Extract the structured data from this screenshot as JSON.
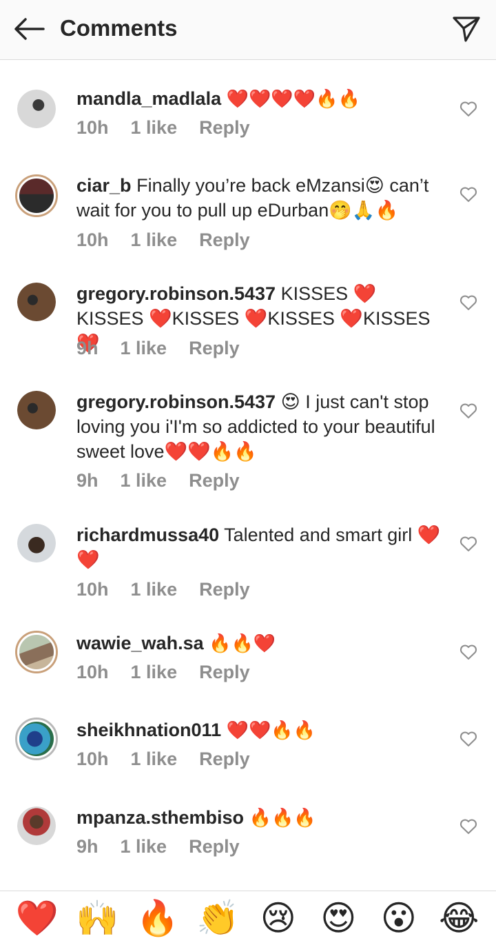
{
  "header": {
    "title": "Comments",
    "back_icon": "arrow-left-icon",
    "send_icon": "paper-plane-icon"
  },
  "comments": [
    {
      "username": "mandla_madlala",
      "text": "",
      "emoji": "❤️❤️❤️❤️🔥🔥",
      "time": "10h",
      "likes": "1 like",
      "reply": "Reply"
    },
    {
      "username": "ciar_b",
      "text": "Finally you’re back eMzansi😍 can’t wait for you to pull up eDurban🤭🙏🔥",
      "emoji": "",
      "time": "10h",
      "likes": "1 like",
      "reply": "Reply"
    },
    {
      "username": "gregory.robinson.5437",
      "text": "KISSES ❤️ KISSES ❤️KISSES ❤️KISSES ❤️KISSES ❤️",
      "emoji": "",
      "time": "9h",
      "likes": "1 like",
      "reply": "Reply"
    },
    {
      "username": "gregory.robinson.5437",
      "text": "😍 I just can't stop loving you i'I'm so addicted to your beautiful sweet love❤️❤️🔥🔥",
      "emoji": "",
      "time": "9h",
      "likes": "1 like",
      "reply": "Reply"
    },
    {
      "username": "richardmussa40",
      "text": "Talented and smart girl ❤️❤️",
      "emoji": "",
      "time": "10h",
      "likes": "1 like",
      "reply": "Reply"
    },
    {
      "username": "wawie_wah.sa",
      "text": "",
      "emoji": "🔥🔥❤️",
      "time": "10h",
      "likes": "1 like",
      "reply": "Reply"
    },
    {
      "username": "sheikhnation011",
      "text": "",
      "emoji": "❤️❤️🔥🔥",
      "time": "10h",
      "likes": "1 like",
      "reply": "Reply"
    },
    {
      "username": "mpanza.sthembiso",
      "text": "",
      "emoji": "🔥🔥🔥",
      "time": "9h",
      "likes": "1 like",
      "reply": "Reply"
    }
  ],
  "quick_reactions": [
    "❤️",
    "🙌",
    "🔥",
    "👏",
    "😢",
    "😍",
    "😮",
    "😂"
  ],
  "colors": {
    "meta": "#8e8e8e",
    "text": "#262626",
    "header_bg": "#fafafa"
  }
}
